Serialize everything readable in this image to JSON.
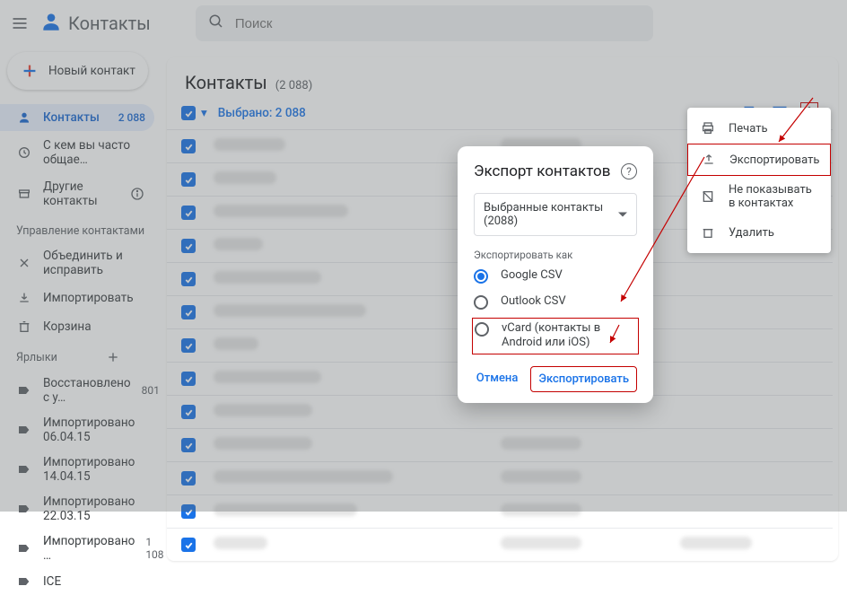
{
  "header": {
    "app_title": "Контакты",
    "search_placeholder": "Поиск"
  },
  "sidebar": {
    "new_contact_label": "Новый контакт",
    "items": [
      {
        "icon": "person",
        "label": "Контакты",
        "count": "2 088",
        "selected": true
      },
      {
        "icon": "history",
        "label": "С кем вы часто общае…",
        "count": ""
      },
      {
        "icon": "archive",
        "label": "Другие контакты",
        "count": "",
        "info": true
      }
    ],
    "section_manage_title": "Управление контактами",
    "manage_items": [
      {
        "icon": "merge",
        "label": "Объединить и исправить"
      },
      {
        "icon": "download",
        "label": "Импортировать"
      },
      {
        "icon": "trash",
        "label": "Корзина"
      }
    ],
    "labels_title": "Ярлыки",
    "labels": [
      {
        "label": "Восстановлено с у…",
        "count": "801"
      },
      {
        "label": "Импортировано 06.04.15",
        "count": ""
      },
      {
        "label": "Импортировано 14.04.15",
        "count": ""
      },
      {
        "label": "Импортировано 22.03.15",
        "count": ""
      },
      {
        "label": "Импортировано …",
        "count": "1 108"
      },
      {
        "label": "ICE",
        "count": ""
      }
    ]
  },
  "main": {
    "title": "Контакты",
    "count": "(2 088)",
    "selected_text": "Выбрано: 2 088",
    "rows": [
      {
        "name_w": 80,
        "phone_w": 90
      },
      {
        "name_w": 70,
        "phone_w": 80
      },
      {
        "name_w": 150,
        "phone_w": 0
      },
      {
        "name_w": 55,
        "phone_w": 0
      },
      {
        "name_w": 120,
        "phone_w": 0
      },
      {
        "name_w": 170,
        "phone_w": 0
      },
      {
        "name_w": 50,
        "phone_w": 0
      },
      {
        "name_w": 120,
        "phone_w": 0
      },
      {
        "name_w": 110,
        "phone_w": 0
      },
      {
        "name_w": 110,
        "phone_w": 90
      },
      {
        "name_w": 200,
        "phone_w": 90
      },
      {
        "name_w": 160,
        "phone_w": 90
      },
      {
        "name_w": 60,
        "phone_w": 90,
        "extra_w": 80
      }
    ]
  },
  "overflow_menu": {
    "items": [
      {
        "icon": "print",
        "label": "Печать"
      },
      {
        "icon": "export",
        "label": "Экспортировать",
        "highlight": true
      },
      {
        "icon": "hide",
        "label": "Не показывать в контактах"
      },
      {
        "icon": "delete",
        "label": "Удалить"
      }
    ]
  },
  "dialog": {
    "title": "Экспорт контактов",
    "selector_label": "Выбранные контакты (2088)",
    "sublabel": "Экспортировать как",
    "options": [
      {
        "label": "Google CSV",
        "selected": true
      },
      {
        "label": "Outlook CSV",
        "selected": false
      },
      {
        "label": "vCard (контакты в Android или iOS)",
        "selected": false,
        "highlight": true
      }
    ],
    "cancel_label": "Отмена",
    "confirm_label": "Экспортировать"
  }
}
